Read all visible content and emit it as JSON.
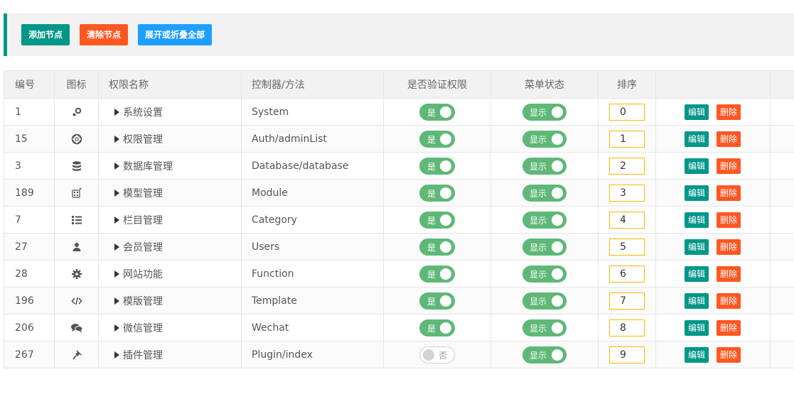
{
  "toolbar": {
    "add_label": "添加节点",
    "clear_label": "清除节点",
    "toggle_label": "展开或折叠全部"
  },
  "columns": [
    "编号",
    "图标",
    "权限名称",
    "控制器/方法",
    "是否验证权限",
    "菜单状态",
    "排序",
    "",
    ""
  ],
  "switch_labels": {
    "yes": "是",
    "no": "否",
    "show": "显示"
  },
  "op_labels": {
    "edit": "编辑",
    "delete": "删除"
  },
  "rows": [
    {
      "id": "1",
      "icon": "gears-icon",
      "name": "系统设置",
      "controller": "System",
      "auth": true,
      "menu": true,
      "sort": "0"
    },
    {
      "id": "15",
      "icon": "lifering-icon",
      "name": "权限管理",
      "controller": "Auth/adminList",
      "auth": true,
      "menu": true,
      "sort": "1"
    },
    {
      "id": "3",
      "icon": "database-icon",
      "name": "数据库管理",
      "controller": "Database/database",
      "auth": true,
      "menu": true,
      "sort": "2"
    },
    {
      "id": "189",
      "icon": "module-icon",
      "name": "模型管理",
      "controller": "Module",
      "auth": true,
      "menu": true,
      "sort": "3"
    },
    {
      "id": "7",
      "icon": "list-icon",
      "name": "栏目管理",
      "controller": "Category",
      "auth": true,
      "menu": true,
      "sort": "4"
    },
    {
      "id": "27",
      "icon": "user-icon",
      "name": "会员管理",
      "controller": "Users",
      "auth": true,
      "menu": true,
      "sort": "5"
    },
    {
      "id": "28",
      "icon": "gear-icon",
      "name": "网站功能",
      "controller": "Function",
      "auth": true,
      "menu": true,
      "sort": "6"
    },
    {
      "id": "196",
      "icon": "code-icon",
      "name": "模版管理",
      "controller": "Template",
      "auth": true,
      "menu": true,
      "sort": "7"
    },
    {
      "id": "206",
      "icon": "comments-icon",
      "name": "微信管理",
      "controller": "Wechat",
      "auth": true,
      "menu": true,
      "sort": "8"
    },
    {
      "id": "267",
      "icon": "plug-icon",
      "name": "插件管理",
      "controller": "Plugin/index",
      "auth": false,
      "menu": true,
      "sort": "9"
    }
  ],
  "colors": {
    "primary": "#009688",
    "danger": "#ff5722",
    "info": "#1e9fff",
    "switch_on": "#5fb878",
    "sort_border": "#ffb800"
  }
}
